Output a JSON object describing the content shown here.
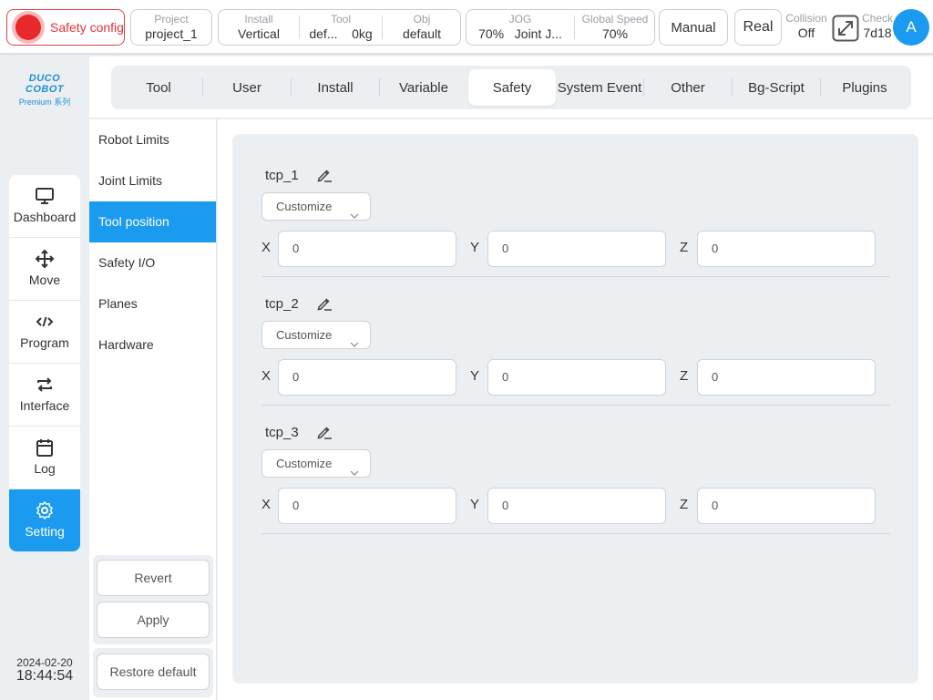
{
  "topbar": {
    "safety_config": "Safety config",
    "project": {
      "key": "Project",
      "value": "project_1"
    },
    "install": {
      "key": "Install",
      "value": "Vertical"
    },
    "tool": {
      "key": "Tool",
      "value_name": "def...",
      "value_weight": "0kg"
    },
    "obj": {
      "key": "Obj",
      "value": "default"
    },
    "jog": {
      "key": "JOG",
      "value_pct": "70%",
      "value_mode": "Joint J..."
    },
    "global_speed": {
      "key": "Global Speed",
      "value": "70%"
    },
    "mode_button": "Manual",
    "real_button": "Real",
    "collision": {
      "key": "Collision",
      "value": "Off"
    },
    "check": {
      "key": "Check",
      "value": "7d18"
    },
    "avatar_letter": "A"
  },
  "logo": {
    "brand": "DUCO COBOT",
    "series": "Premium 系列"
  },
  "nav": {
    "items": [
      {
        "label": "Dashboard",
        "icon": "monitor-icon"
      },
      {
        "label": "Move",
        "icon": "move-arrows-icon"
      },
      {
        "label": "Program",
        "icon": "code-icon"
      },
      {
        "label": "Interface",
        "icon": "swap-icon"
      },
      {
        "label": "Log",
        "icon": "calendar-icon"
      },
      {
        "label": "Setting",
        "icon": "gear-icon",
        "active": true
      }
    ]
  },
  "datetime": {
    "date": "2024-02-20",
    "time": "18:44:54"
  },
  "tabs": [
    "Tool",
    "User",
    "Install",
    "Variable",
    "Safety",
    "System Event",
    "Other",
    "Bg-Script",
    "Plugins"
  ],
  "active_tab": "Safety",
  "submenu": {
    "items": [
      "Robot Limits",
      "Joint Limits",
      "Tool position",
      "Safety I/O",
      "Planes",
      "Hardware"
    ],
    "active": "Tool position",
    "revert": "Revert",
    "apply": "Apply",
    "restore": "Restore default"
  },
  "tcps": [
    {
      "name": "tcp_1",
      "mode": "Customize",
      "x": "0",
      "y": "0",
      "z": "0"
    },
    {
      "name": "tcp_2",
      "mode": "Customize",
      "x": "0",
      "y": "0",
      "z": "0"
    },
    {
      "name": "tcp_3",
      "mode": "Customize",
      "x": "0",
      "y": "0",
      "z": "0"
    }
  ],
  "axis_labels": {
    "x": "X",
    "y": "Y",
    "z": "Z"
  },
  "colors": {
    "accent": "#1b9bf0",
    "alarm": "#e8282d"
  }
}
